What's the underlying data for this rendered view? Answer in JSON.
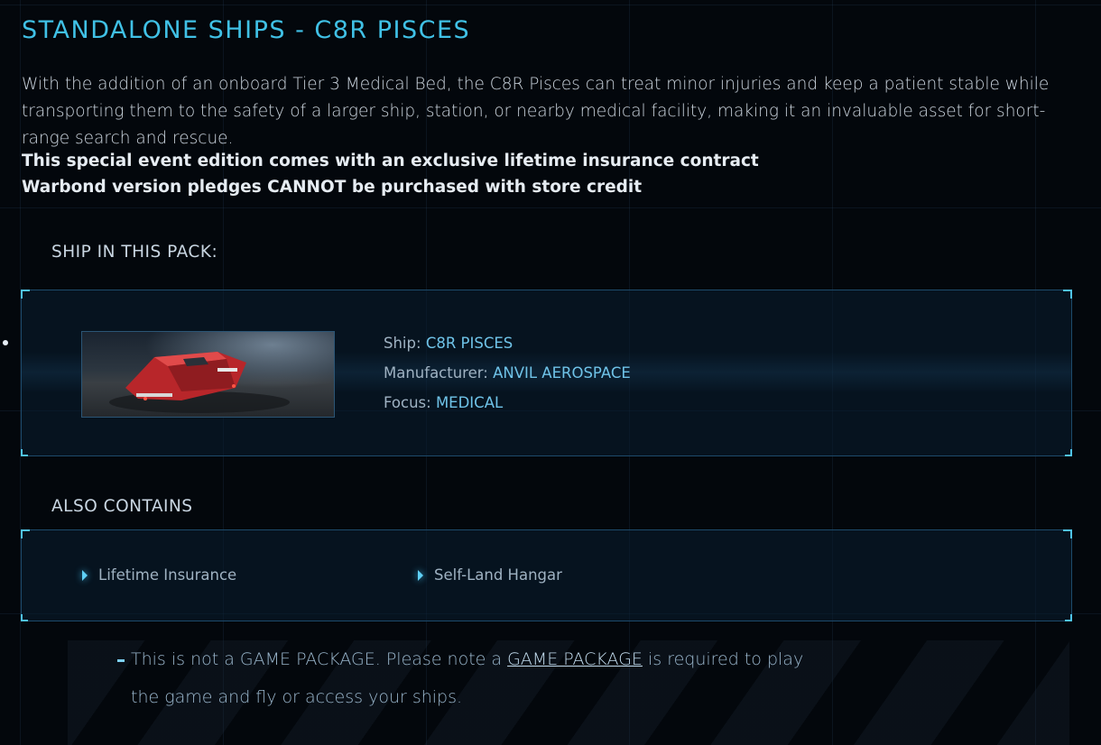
{
  "page": {
    "title": "STANDALONE SHIPS - C8R PISCES",
    "description": "With the addition of an onboard Tier 3 Medical Bed, the C8R Pisces can treat minor injuries and keep a patient stable while transporting them to the safety of a larger ship, station, or nearby medical facility, making it an invaluable asset for short-range search and rescue.",
    "bold_lines": [
      "This special event edition comes with an exclusive lifetime insurance contract",
      "Warbond version pledges CANNOT be purchased with store credit"
    ]
  },
  "ship_section": {
    "label": "SHIP IN THIS PACK:",
    "ship_label": "Ship:",
    "ship_value": "C8R PISCES",
    "manufacturer_label": "Manufacturer:",
    "manufacturer_value": "ANVIL AEROSPACE",
    "focus_label": "Focus:",
    "focus_value": "MEDICAL"
  },
  "contains_section": {
    "label": "ALSO CONTAINS",
    "items": [
      "Lifetime Insurance",
      "Self-Land Hangar"
    ]
  },
  "note": {
    "before_link": "This is not a GAME PACKAGE. Please note a ",
    "link": "GAME PACKAGE",
    "after_link": " is required to play",
    "line2": "the game and fly or access your ships."
  },
  "colors": {
    "accent": "#40c1e6",
    "background": "#03070c",
    "panel_border": "#1d4a6b",
    "ship_hull": "#c0282a"
  }
}
